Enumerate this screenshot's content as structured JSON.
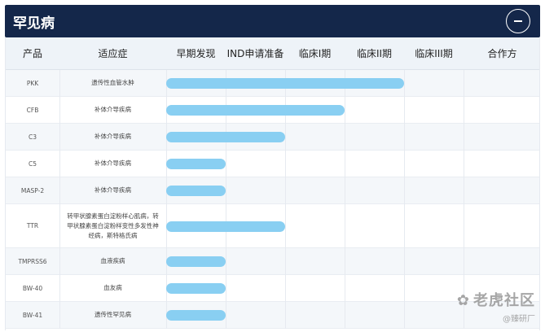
{
  "header": {
    "title": "罕见病",
    "collapse_icon": "minus-circle-icon"
  },
  "columns": [
    "产品",
    "适应症",
    "早期发现",
    "IND申请准备",
    "临床I期",
    "临床II期",
    "临床III期",
    "合作方"
  ],
  "stages": [
    "早期发现",
    "IND申请准备",
    "临床I期",
    "临床II期",
    "临床III期"
  ],
  "rows": [
    {
      "product": "PKK",
      "indication": "遗传性血管水肿",
      "progress_stage": 4
    },
    {
      "product": "CFB",
      "indication": "补体介导疾病",
      "progress_stage": 3
    },
    {
      "product": "C3",
      "indication": "补体介导疾病",
      "progress_stage": 2
    },
    {
      "product": "C5",
      "indication": "补体介导疾病",
      "progress_stage": 1
    },
    {
      "product": "MASP-2",
      "indication": "补体介导疾病",
      "progress_stage": 1
    },
    {
      "product": "TTR",
      "indication": "转甲状腺素蛋白淀粉样心肌病，转甲状腺素蛋白淀粉样变性多发性神经病，斯特格氏病",
      "progress_stage": 2
    },
    {
      "product": "TMPRSS6",
      "indication": "血液疾病",
      "progress_stage": 1
    },
    {
      "product": "BW-40",
      "indication": "血友病",
      "progress_stage": 1
    },
    {
      "product": "BW-41",
      "indication": "遗传性罕见病",
      "progress_stage": 1
    }
  ],
  "colors": {
    "header_bg": "#14274a",
    "bar": "#89cff2",
    "thead_bg": "#eef3f8"
  },
  "watermark": {
    "main": "老虎社区",
    "sub": "@臻研厂",
    "icon": "tiger-logo-icon"
  }
}
